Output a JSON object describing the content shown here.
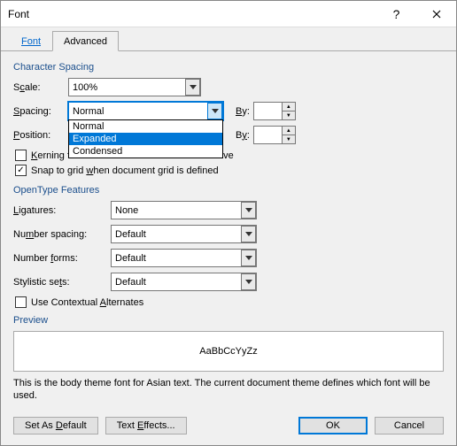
{
  "title": "Font",
  "tabs": {
    "font": "Font",
    "advanced": "Advanced"
  },
  "char_spacing": {
    "group": "Character Spacing",
    "scale_label": "Scale:",
    "scale_value": "100%",
    "spacing_label": "Spacing:",
    "spacing_value": "Normal",
    "spacing_options": {
      "normal": "Normal",
      "expanded": "Expanded",
      "condensed": "Condensed"
    },
    "position_label": "Position:",
    "by_label": "By:",
    "kerning_label_pre": "Kerning for fonts:",
    "kerning_label_post": "Points and above",
    "snap_label": "Snap to grid when document grid is defined"
  },
  "opentype": {
    "group": "OpenType Features",
    "ligatures_label": "Ligatures:",
    "ligatures_value": "None",
    "numspacing_label": "Number spacing:",
    "numspacing_value": "Default",
    "numforms_label": "Number forms:",
    "numforms_value": "Default",
    "stylistic_label": "Stylistic sets:",
    "stylistic_value": "Default",
    "contextual_label": "Use Contextual Alternates"
  },
  "preview": {
    "group": "Preview",
    "sample": "AaBbCcYyZz",
    "desc": "This is the body theme font for Asian text. The current document theme defines which font will be used."
  },
  "buttons": {
    "default": "Set As Default",
    "effects": "Text Effects...",
    "ok": "OK",
    "cancel": "Cancel"
  }
}
